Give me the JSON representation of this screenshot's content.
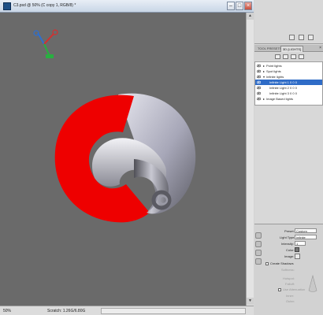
{
  "window": {
    "title": "C3.psd @ 50% (C copy 1, RGB/8) *",
    "minimize_glyph": "–",
    "maximize_glyph": "□",
    "close_glyph": "×"
  },
  "status": {
    "zoom": "50%",
    "scratch": "Scratch: 1.26G/6.80G"
  },
  "panel": {
    "tabs": [
      "TOOL PRESETS",
      "3D {LIGHTS}"
    ],
    "tab_close": "×",
    "lights": [
      {
        "label": "Point lights",
        "level": 0
      },
      {
        "label": "Spot lights",
        "level": 0
      },
      {
        "label": "Infinite lights",
        "level": 0
      },
      {
        "label": "Infinite Light 1 0 0 0",
        "level": 1,
        "selected": true
      },
      {
        "label": "Infinite Light 2 0 0 0",
        "level": 1
      },
      {
        "label": "Infinite Light 3 0 0 0",
        "level": 1
      },
      {
        "label": "Image Based lights",
        "level": 0
      }
    ]
  },
  "properties": {
    "preset_label": "Preset:",
    "preset_value": "Custom",
    "light_type_label": "Light Type:",
    "light_type_value": "Infinite",
    "intensity_label": "Intensity:",
    "intensity_value": "1",
    "color_label": "Color:",
    "image_label": "Image:",
    "create_shadows": "Create Shadows",
    "softness_label": "Softness:",
    "hotspot_label": "Hotspot:",
    "falloff_label": "Falloff:",
    "use_attenuation": "Use Attenuation",
    "inner_label": "Inner:",
    "outer_label": "Outer:"
  },
  "colors": {
    "red_surface": "#ee0000",
    "selection_blue": "#2f6cc7",
    "canvas_gray": "#6a6a6a"
  }
}
